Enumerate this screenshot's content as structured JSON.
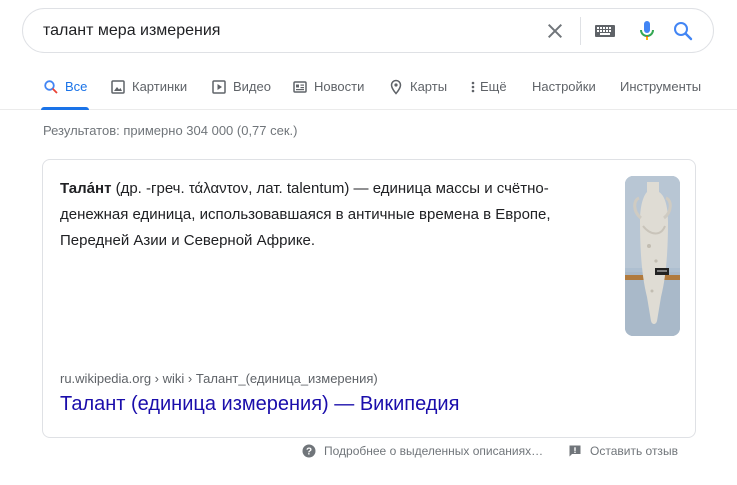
{
  "search": {
    "query": "талант мера измерения"
  },
  "tabs": [
    {
      "label": "Все",
      "icon": "search-icon",
      "active": true
    },
    {
      "label": "Картинки",
      "icon": "image-icon"
    },
    {
      "label": "Видео",
      "icon": "video-icon"
    },
    {
      "label": "Новости",
      "icon": "news-icon"
    },
    {
      "label": "Карты",
      "icon": "map-pin-icon"
    },
    {
      "label": "Ещё",
      "icon": "more-vertical-icon"
    },
    {
      "label": "Настройки"
    },
    {
      "label": "Инструменты"
    }
  ],
  "stats": "Результатов: примерно 304 000 (0,77 сек.)",
  "snippet": {
    "term": "Тала́нт",
    "text_line1": " (др. -греч. τάλαντον, лат. talentum) — единица массы и счётно-",
    "text_line2": "денежная единица, использовавшаяся в античные времена в Европе,",
    "text_line3": "Передней Азии и Северной Африке."
  },
  "result": {
    "cite": "ru.wikipedia.org › wiki › Талант_(единица_измерения)",
    "title": "Талант (единица измерения) — Википедия"
  },
  "footer": {
    "about": "Подробнее о выделенных описаниях…",
    "feedback": "Оставить отзыв"
  },
  "colors": {
    "link": "#1a0dab",
    "accent": "#1a73e8",
    "muted": "#70757a"
  }
}
